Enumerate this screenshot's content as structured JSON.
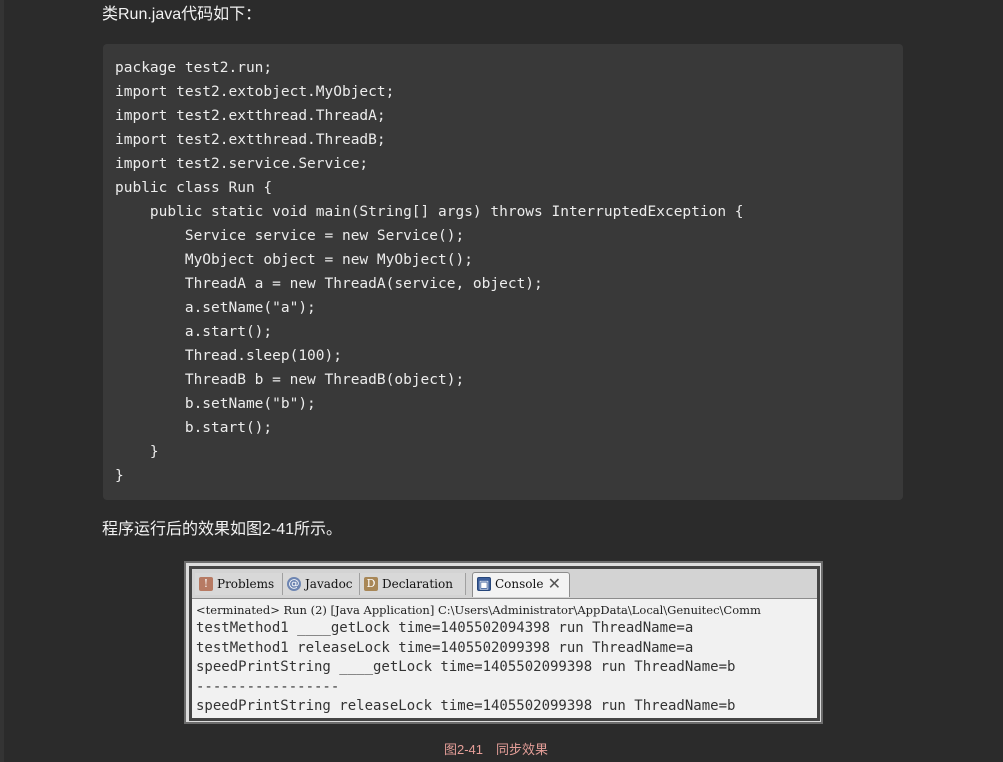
{
  "article": {
    "intro_text": "类Run.java代码如下：",
    "result_text": "程序运行后的效果如图2-41所示。",
    "figure_caption": "图2-41　同步效果"
  },
  "code_block": {
    "lines": [
      "package test2.run;",
      "import test2.extobject.MyObject;",
      "import test2.extthread.ThreadA;",
      "import test2.extthread.ThreadB;",
      "import test2.service.Service;",
      "public class Run {",
      "    public static void main(String[] args) throws InterruptedException {",
      "        Service service = new Service();",
      "        MyObject object = new MyObject();",
      "        ThreadA a = new ThreadA(service, object);",
      "        a.setName(\"a\");",
      "        a.start();",
      "        Thread.sleep(100);",
      "        ThreadB b = new ThreadB(object);",
      "        b.setName(\"b\");",
      "        b.start();",
      "    }",
      "}"
    ]
  },
  "embedded_screenshot": {
    "tabs": [
      {
        "label": "Problems",
        "icon": "problems-icon"
      },
      {
        "label": "Javadoc",
        "icon": "javadoc-icon"
      },
      {
        "label": "Declaration",
        "icon": "declaration-icon"
      },
      {
        "label": "Console",
        "icon": "console-icon"
      }
    ],
    "close_symbol": "✕",
    "icon_symbols": {
      "problems": "!",
      "javadoc": "@",
      "declaration": "D",
      "console": "▣"
    },
    "terminated_line": "<terminated> Run (2) [Java Application] C:\\Users\\Administrator\\AppData\\Local\\Genuitec\\Comm",
    "console_lines": [
      "testMethod1 ____getLock time=1405502094398 run ThreadName=a",
      "testMethod1 releaseLock time=1405502099398 run ThreadName=a",
      "speedPrintString ____getLock time=1405502099398 run ThreadName=b",
      "-----------------",
      "speedPrintString releaseLock time=1405502099398 run ThreadName=b"
    ]
  }
}
